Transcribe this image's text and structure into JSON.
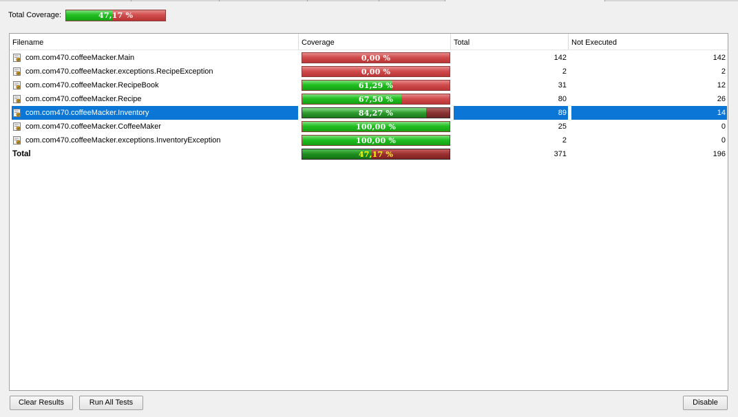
{
  "summary": {
    "label": "Total Coverage:",
    "coverage_text": "47,17 %",
    "coverage_fraction": 0.4717
  },
  "table": {
    "columns": [
      "Filename",
      "Coverage",
      "Total",
      "Not Executed"
    ],
    "rows": [
      {
        "name": "com.com470.coffeeMacker.Main",
        "coverage_text": "0,00 %",
        "coverage_fraction": 0.0,
        "total": "142",
        "not_executed": "142",
        "selected": false
      },
      {
        "name": "com.com470.coffeeMacker.exceptions.RecipeException",
        "coverage_text": "0,00 %",
        "coverage_fraction": 0.0,
        "total": "2",
        "not_executed": "2",
        "selected": false
      },
      {
        "name": "com.com470.coffeeMacker.RecipeBook",
        "coverage_text": "61,29 %",
        "coverage_fraction": 0.6129,
        "total": "31",
        "not_executed": "12",
        "selected": false
      },
      {
        "name": "com.com470.coffeeMacker.Recipe",
        "coverage_text": "67,50 %",
        "coverage_fraction": 0.675,
        "total": "80",
        "not_executed": "26",
        "selected": false
      },
      {
        "name": "com.com470.coffeeMacker.Inventory",
        "coverage_text": "84,27 %",
        "coverage_fraction": 0.8427,
        "total": "89",
        "not_executed": "14",
        "selected": true
      },
      {
        "name": "com.com470.coffeeMacker.CoffeeMaker",
        "coverage_text": "100,00 %",
        "coverage_fraction": 1.0,
        "total": "25",
        "not_executed": "0",
        "selected": false
      },
      {
        "name": "com.com470.coffeeMacker.exceptions.InventoryException",
        "coverage_text": "100,00 %",
        "coverage_fraction": 1.0,
        "total": "2",
        "not_executed": "0",
        "selected": false
      }
    ],
    "total_row": {
      "name": "Total",
      "coverage_text": "47,17 %",
      "coverage_fraction": 0.4717,
      "total": "371",
      "not_executed": "196"
    }
  },
  "buttons": {
    "clear_results": "Clear Results",
    "run_all_tests": "Run All Tests",
    "disable": "Disable"
  },
  "colors": {
    "selection": "#0b76d6",
    "covered": "#22bf22",
    "uncovered": "#d04d4d",
    "total_text": "#ffff00"
  },
  "icons": {
    "file": "java-class-file-icon"
  }
}
